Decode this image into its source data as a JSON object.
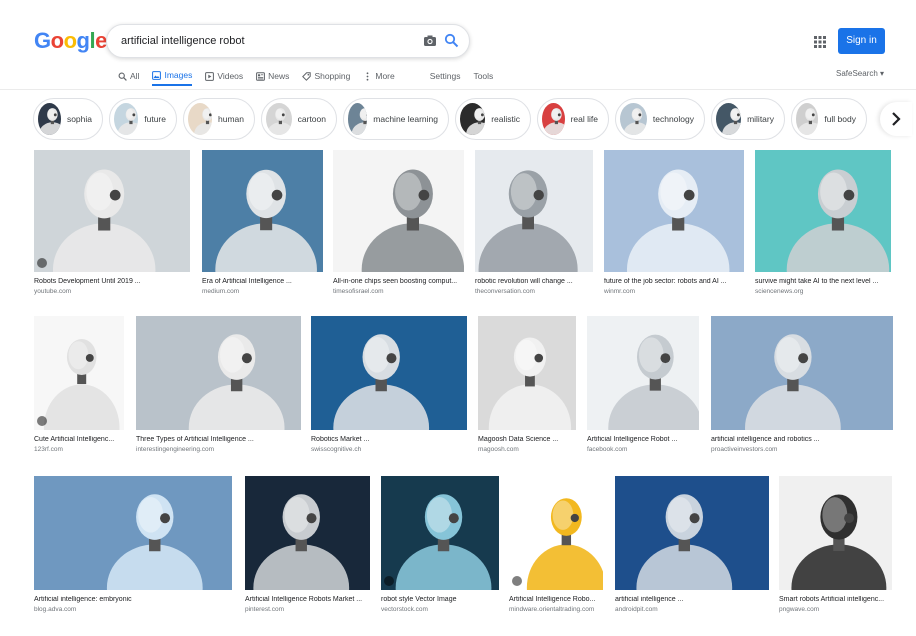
{
  "header": {
    "logo": [
      "G",
      "o",
      "o",
      "g",
      "l",
      "e"
    ],
    "logo_colors": [
      "#4285F4",
      "#EA4335",
      "#FBBC05",
      "#4285F4",
      "#34A853",
      "#EA4335"
    ],
    "query": "artificial intelligence robot",
    "sign_in": "Sign in",
    "safesearch": "SafeSearch ▾"
  },
  "tabs": [
    {
      "label": "All",
      "icon": "search-icon"
    },
    {
      "label": "Images",
      "icon": "image-icon",
      "active": true
    },
    {
      "label": "Videos",
      "icon": "video-icon"
    },
    {
      "label": "News",
      "icon": "news-icon"
    },
    {
      "label": "Shopping",
      "icon": "tag-icon"
    },
    {
      "label": "More",
      "icon": "more-icon"
    },
    {
      "label": "Settings"
    },
    {
      "label": "Tools"
    }
  ],
  "chips": [
    "sophia",
    "future",
    "human",
    "cartoon",
    "machine learning",
    "realistic",
    "real life",
    "technology",
    "military",
    "full body"
  ],
  "rows": [
    [
      {
        "title": "Robots Development Until 2019 ...",
        "source": "youtube.com",
        "bg": "#cfd5d9",
        "fg": "#e9e9e9"
      },
      {
        "title": "Era of Artificial Intelligence ...",
        "source": "medium.com",
        "bg": "#4d7fa6",
        "fg": "#dfe3e6"
      },
      {
        "title": "All-in-one chips seen boosting comput...",
        "source": "timesofisrael.com",
        "bg": "#f4f4f4",
        "fg": "#8d9296"
      },
      {
        "title": "robotic revolution will change ...",
        "source": "theconversation.com",
        "bg": "#e6eaee",
        "fg": "#9aa1a7"
      },
      {
        "title": "future of the job sector: robots and AI ...",
        "source": "winmr.com",
        "bg": "#a9c0dc",
        "fg": "#e6edf5"
      },
      {
        "title": "survive might take AI to the next level ...",
        "source": "sciencenews.org",
        "bg": "#5fc6c4",
        "fg": "#c9ced2"
      }
    ],
    [
      {
        "title": "Cute Artificial Intelligenc...",
        "source": "123rf.com",
        "bg": "#f7f7f7",
        "fg": "#e1e1e1"
      },
      {
        "title": "Three Types of Artificial Intelligence ...",
        "source": "interestingengineering.com",
        "bg": "#b9c2ca",
        "fg": "#eaeaea"
      },
      {
        "title": "Robotics Market ...",
        "source": "swisscognitive.ch",
        "bg": "#1f5f95",
        "fg": "#d7dde2"
      },
      {
        "title": "Magoosh Data Science ...",
        "source": "magoosh.com",
        "bg": "#dadada",
        "fg": "#f1f1f1"
      },
      {
        "title": "Artificial Intelligence Robot ...",
        "source": "facebook.com",
        "bg": "#eef1f3",
        "fg": "#c5cbd0"
      },
      {
        "title": "artificial intelligence and robotics ...",
        "source": "proactiveinvestors.com",
        "bg": "#8ca9c8",
        "fg": "#d8dde2"
      }
    ],
    [
      {
        "title": "Artificial intelligence: embryonic",
        "source": "blog.adva.com",
        "bg": "#6f98c0",
        "fg": "#cfe3f3"
      },
      {
        "title": "Artificial Intelligence Robots Market ...",
        "source": "pinterest.com",
        "bg": "#18283a",
        "fg": "#c8ccd0"
      },
      {
        "title": "robot style Vector Image",
        "source": "vectorstock.com",
        "bg": "#163a4e",
        "fg": "#86c4d8"
      },
      {
        "title": "Artificial Intelligence Robo...",
        "source": "mindware.orientaltrading.com",
        "bg": "#ffffff",
        "fg": "#f2b81f"
      },
      {
        "title": "artificial intelligence ...",
        "source": "androidpit.com",
        "bg": "#1e4f8c",
        "fg": "#c9d3de"
      },
      {
        "title": "Smart robots Artificial intelligenc...",
        "source": "pngwave.com",
        "bg": "#f0f0f0",
        "fg": "#2f2f2f"
      }
    ]
  ]
}
